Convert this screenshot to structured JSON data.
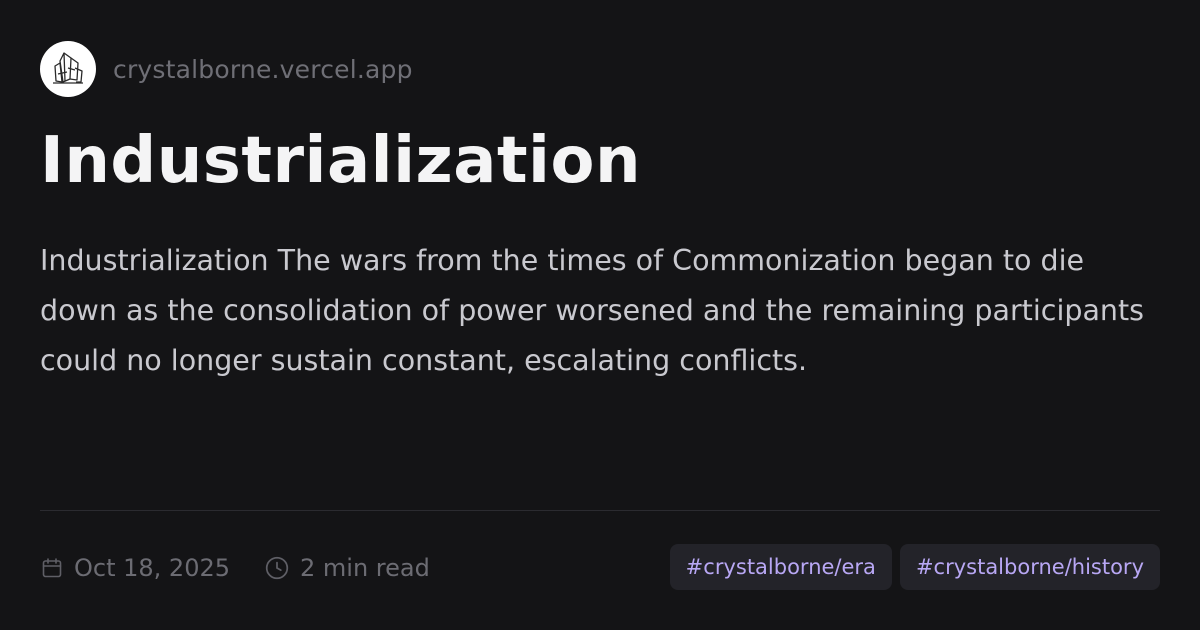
{
  "site": {
    "name": "crystalborne.vercel.app",
    "logo_icon": "crystal-cluster-icon"
  },
  "post": {
    "title": "Industrialization",
    "description": "Industrialization The wars from the times of Commonization began to die down as the consolidation of power worsened and the remaining participants could no longer sustain constant, escalating conflicts."
  },
  "meta": {
    "date": "Oct 18, 2025",
    "date_icon": "calendar-icon",
    "read_time": "2 min read",
    "read_time_icon": "clock-icon"
  },
  "tags": [
    "#crystalborne/era",
    "#crystalborne/history"
  ],
  "colors": {
    "background": "#141416",
    "title": "#f4f4f5",
    "description": "#c9c9cf",
    "muted": "#6c6c73",
    "tag_text": "#b8a7f4",
    "tag_background": "#232329"
  }
}
